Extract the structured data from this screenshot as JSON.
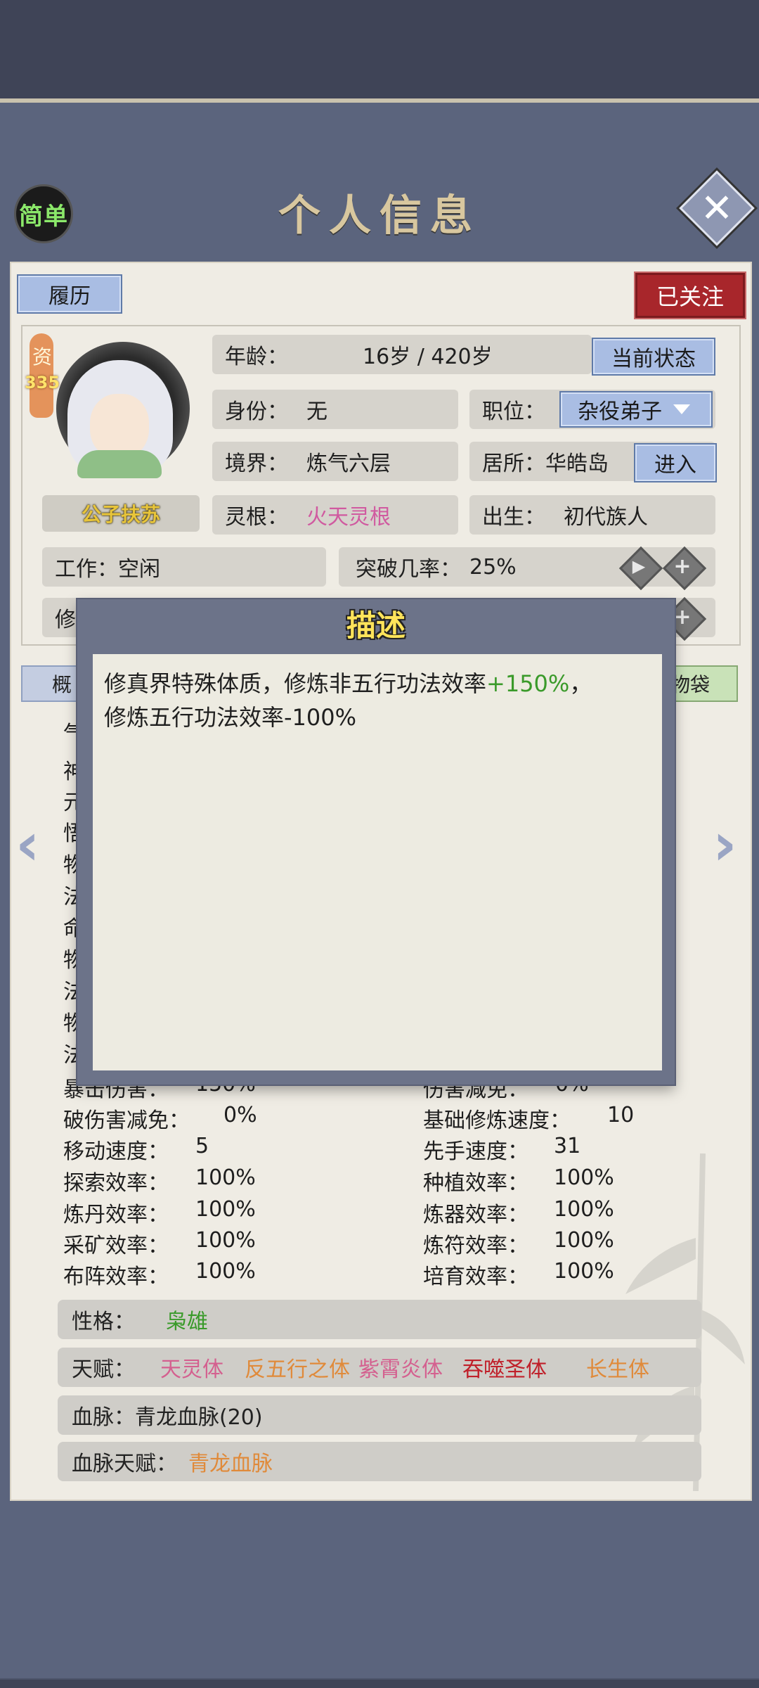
{
  "header": {
    "simple_label": "简单",
    "title": "个人信息",
    "close_icon": "close-icon"
  },
  "panel": {
    "resume_label": "履历",
    "follow_label": "已关注",
    "aptitude": {
      "char": "资",
      "value": "335"
    },
    "character_name": "公子扶苏",
    "age": {
      "label": "年龄：",
      "value": "16岁 / 420岁"
    },
    "current_status_label": "当前状态",
    "identity": {
      "label": "身份：",
      "value": "无"
    },
    "position": {
      "label": "职位：",
      "value": "杂役弟子"
    },
    "realm": {
      "label": "境界：",
      "value": "炼气六层"
    },
    "residence": {
      "label": "居所：",
      "value": "华皓岛"
    },
    "enter_label": "进入",
    "spirit_root": {
      "label": "灵根：",
      "value": "火天灵根"
    },
    "birth": {
      "label": "出生：",
      "value": "初代族人"
    },
    "work": {
      "label": "工作：",
      "value": "空闲"
    },
    "breakthrough": {
      "label": "突破几率：",
      "value": "25%"
    },
    "row6_partial": "修",
    "tab_left_partial": "概",
    "tab_right_partial": "物袋"
  },
  "stats_left_partial": [
    "气",
    "神",
    "元",
    "悟",
    "物",
    "法",
    "命",
    "物",
    "法",
    "物",
    "法"
  ],
  "stats_row_partial": {
    "left": "暴击伤害：",
    "left_value": "150%",
    "right": "伤害减免：",
    "right_value": "0%"
  },
  "stats": [
    {
      "l_label": "破伤害减免：",
      "l_value": "0%",
      "r_label": "基础修炼速度：",
      "r_value": "10"
    },
    {
      "l_label": "移动速度：",
      "l_value": "5",
      "r_label": "先手速度：",
      "r_value": "31"
    },
    {
      "l_label": "探索效率：",
      "l_value": "100%",
      "r_label": "种植效率：",
      "r_value": "100%"
    },
    {
      "l_label": "炼丹效率：",
      "l_value": "100%",
      "r_label": "炼器效率：",
      "r_value": "100%"
    },
    {
      "l_label": "采矿效率：",
      "l_value": "100%",
      "r_label": "炼符效率：",
      "r_value": "100%"
    },
    {
      "l_label": "布阵效率：",
      "l_value": "100%",
      "r_label": "培育效率：",
      "r_value": "100%"
    }
  ],
  "personality": {
    "label": "性格：",
    "value": "枭雄"
  },
  "talents": {
    "label": "天赋：",
    "items": [
      "天灵体",
      "反五行之体",
      "紫霄炎体",
      "吞噬圣体",
      "长生体"
    ]
  },
  "bloodline": {
    "label": "血脉：",
    "value": "青龙血脉(20)"
  },
  "bloodline_talent": {
    "label": "血脉天赋：",
    "value": "青龙血脉"
  },
  "popup": {
    "title": "描述",
    "text_part1": "修真界特殊体质，修炼非五行功法效率",
    "text_highlight": "+150%",
    "text_part2": "，",
    "text_line2": "修炼五行功法效率-100%"
  },
  "colors": {
    "purple_root": "#d05aa0",
    "green": "#3a9a2a",
    "pink": "#d4608f",
    "orange": "#e08a3a",
    "red": "#c0202a"
  }
}
